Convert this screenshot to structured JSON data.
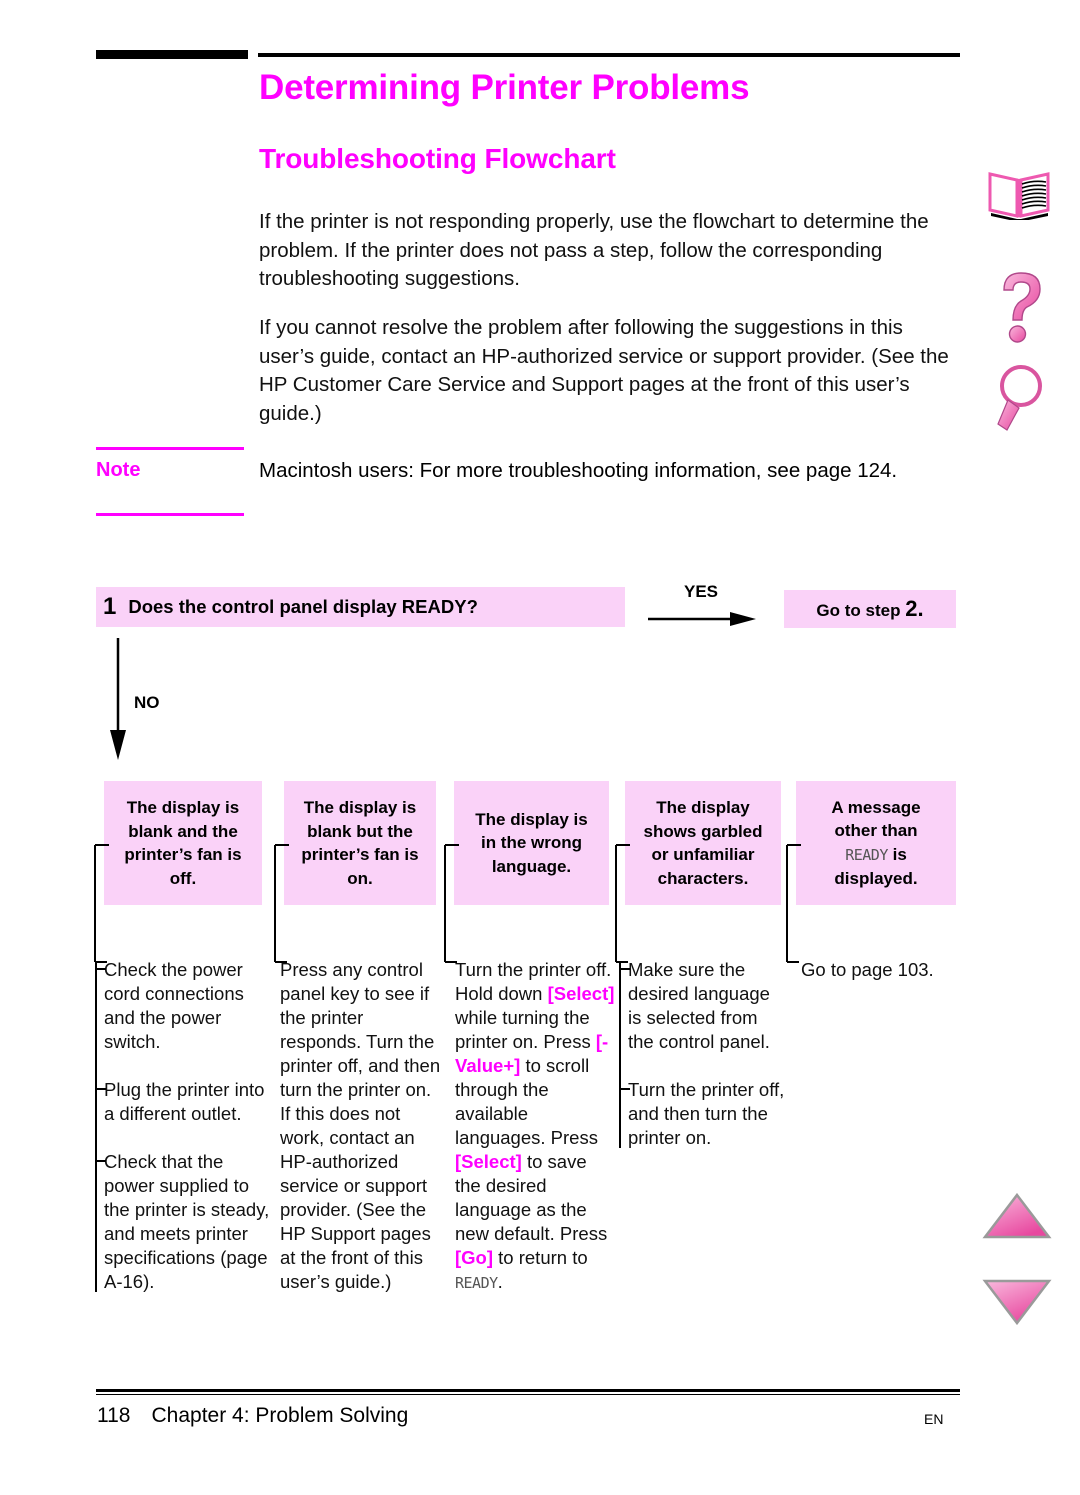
{
  "page": {
    "title": "Determining Printer Problems",
    "section_title": "Troubleshooting Flowchart",
    "intro_paragraph_1": "If the printer is not responding properly, use the flowchart to determine the problem. If the printer does not pass a step, follow the corresponding troubleshooting suggestions.",
    "intro_paragraph_2": "If you cannot resolve the problem after following the suggestions in this user’s guide, contact an HP-authorized service or support provider. (See the HP Customer Care Service and Support pages at the front of this user’s guide.)"
  },
  "note": {
    "label": "Note",
    "text": "Macintosh users: For more troubleshooting information, see page 124."
  },
  "flowchart": {
    "step_number": "1",
    "step_question": "Does the control panel display READY?",
    "yes_label": "YES",
    "no_label": "NO",
    "goto_prefix": "Go to step ",
    "goto_step": "2.",
    "symptoms": [
      {
        "id": "display-blank-fan-off",
        "lines": [
          "The display is",
          "blank and the",
          "printer’s fan is",
          "off."
        ]
      },
      {
        "id": "display-blank-fan-on",
        "lines": [
          "The display is",
          "blank but the",
          "printer’s fan is",
          "on."
        ]
      },
      {
        "id": "display-wrong-language",
        "lines": [
          "The display is",
          "in the wrong",
          "language."
        ]
      },
      {
        "id": "display-garbled",
        "lines": [
          "The display",
          "shows garbled",
          "or unfamiliar",
          "characters."
        ]
      },
      {
        "id": "message-other-than-ready",
        "lines": [
          "A message",
          "other than",
          "READY is",
          "displayed."
        ],
        "lcd_line_index": 2,
        "lcd_word": "READY",
        "lcd_suffix": " is"
      }
    ],
    "remedies": [
      {
        "id": "remedy-power",
        "bulleted": true,
        "paragraphs": [
          "Check the power cord connections and the power switch.",
          "Plug the printer into a different outlet.",
          "Check that the power supplied to the printer is steady, and meets printer specifications (page A-16)."
        ]
      },
      {
        "id": "remedy-fan-on",
        "bulleted": false,
        "paragraphs": [
          "Press any control panel key to see if the printer responds. Turn the printer off, and then turn the printer on. If this does not work, contact an HP-authorized service or support provider. (See the HP Support pages at the front of this user’s guide.)"
        ]
      },
      {
        "id": "remedy-language",
        "bulleted": false,
        "rich": [
          {
            "t": "Turn the printer off. Hold down "
          },
          {
            "t": "[Select]",
            "k": true
          },
          {
            "t": " while turning the printer on. Press "
          },
          {
            "t": "[-Value+]",
            "k": true
          },
          {
            "t": " to scroll through the available languages. Press "
          },
          {
            "t": "[Select]",
            "k": true
          },
          {
            "t": " to save the desired language as the new default. Press "
          },
          {
            "t": "[Go]",
            "k": true
          },
          {
            "t": " to return to "
          },
          {
            "t": "READY",
            "lcd": true
          },
          {
            "t": "."
          }
        ]
      },
      {
        "id": "remedy-garbled",
        "bulleted": true,
        "paragraphs": [
          "Make sure the desired language is selected from the control panel.",
          "Turn the printer off, and then turn the printer on."
        ]
      },
      {
        "id": "remedy-other-message",
        "bulleted": false,
        "paragraphs": [
          "Go to page 103."
        ]
      }
    ]
  },
  "footer": {
    "page_number": "118",
    "chapter": "Chapter 4:  Problem Solving",
    "language_code": "EN"
  },
  "colors": {
    "accent": "#ff00ff",
    "box_fill": "#fad2f8",
    "icon_pink": "#ee59b0",
    "icon_pink_light": "#f9a8d4"
  }
}
